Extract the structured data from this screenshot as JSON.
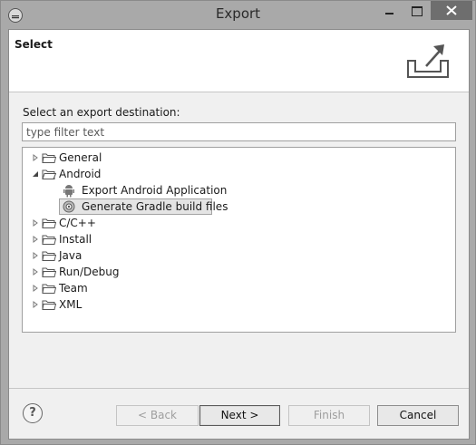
{
  "window": {
    "title": "Export"
  },
  "header": {
    "title": "Select"
  },
  "prompt": "Select an export destination:",
  "filter": {
    "placeholder": "type filter text",
    "value": ""
  },
  "tree": {
    "items": [
      {
        "label": "General",
        "expanded": false
      },
      {
        "label": "Android",
        "expanded": true,
        "children": [
          {
            "label": "Export Android Application"
          },
          {
            "label": "Generate Gradle build files",
            "selected": true
          }
        ]
      },
      {
        "label": "C/C++",
        "expanded": false
      },
      {
        "label": "Install",
        "expanded": false
      },
      {
        "label": "Java",
        "expanded": false
      },
      {
        "label": "Run/Debug",
        "expanded": false
      },
      {
        "label": "Team",
        "expanded": false
      },
      {
        "label": "XML",
        "expanded": false
      }
    ]
  },
  "buttons": {
    "help": "?",
    "back": "< Back",
    "next": "Next >",
    "finish": "Finish",
    "cancel": "Cancel"
  },
  "colors": {
    "chrome": "#a9a9a9",
    "dialog_bg": "#f0f0f0",
    "selection": "#e4e4e4"
  }
}
